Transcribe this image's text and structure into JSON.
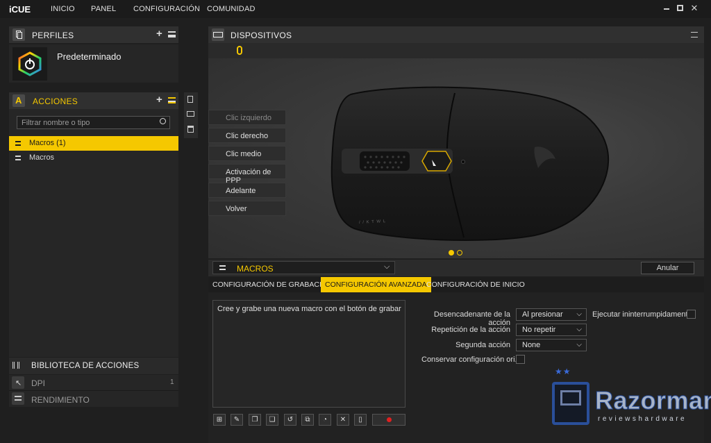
{
  "app": {
    "brand": "iCUE"
  },
  "nav": {
    "items": [
      "INICIO",
      "PANEL",
      "CONFIGURACIÓN",
      "COMUNIDAD"
    ]
  },
  "profiles": {
    "title": "PERFILES",
    "profile_name": "Predeterminado"
  },
  "actions": {
    "title": "ACCIONES",
    "filter_placeholder": "Filtrar nombre o tipo",
    "items": [
      {
        "label": "Macros (1)",
        "selected": true
      },
      {
        "label": "Macros",
        "selected": false
      }
    ]
  },
  "library": {
    "title": "BIBLIOTECA DE ACCIONES",
    "items": [
      {
        "label": "DPI",
        "count": "1"
      },
      {
        "label": "RENDIMIENTO",
        "count": ""
      }
    ]
  },
  "devices": {
    "title": "DISPOSITIVOS",
    "mouse_buttons": [
      "Clic izquierdo",
      "Clic derecho",
      "Clic medio",
      "Activación de PPP",
      "Adelante",
      "Volver"
    ],
    "mouse_brand_text": "/ / K T W L"
  },
  "macros": {
    "title": "MACROS",
    "cancel_label": "Anular",
    "tabs": [
      "CONFIGURACIÓN DE GRABACIÓN",
      "CONFIGURACIÓN AVANZADA",
      "CONFIGURACIÓN DE INICIO"
    ],
    "active_tab": 1,
    "editor_text": "Cree y grabe una nueva macro con el botón de grabar",
    "settings": {
      "trigger_label": "Desencadenante de la acción",
      "trigger_value": "Al presionar",
      "run_uninterrupted_label": "Ejecutar ininterrumpidamente",
      "repeat_label": "Repetición de la acción",
      "repeat_value": "No repetir",
      "second_action_label": "Segunda acción",
      "second_action_value": "None",
      "keep_settings_label": "Conservar configuración ori..."
    }
  },
  "watermark": {
    "name": "Razorman",
    "subtitle": "Reviewshardware"
  },
  "colors": {
    "accent": "#f5c800",
    "panel": "#262626",
    "header": "#303030",
    "background": "#1f1f1f"
  }
}
